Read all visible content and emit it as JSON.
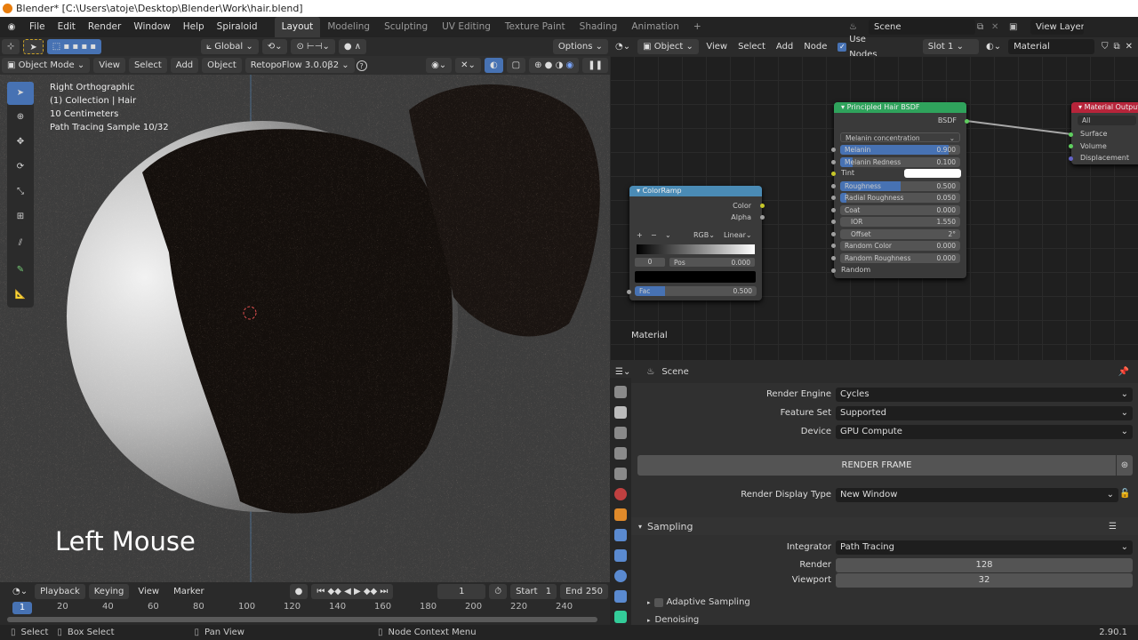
{
  "window": {
    "title": "Blender* [C:\\Users\\atoje\\Desktop\\Blender\\Work\\hair.blend]"
  },
  "menu": [
    "File",
    "Edit",
    "Render",
    "Window",
    "Help",
    "Spiraloid"
  ],
  "workspaces": [
    "Layout",
    "Modeling",
    "Sculpting",
    "UV Editing",
    "Texture Paint",
    "Shading",
    "Animation"
  ],
  "workspace_add": "+",
  "topright": {
    "scene": "Scene",
    "view_layer": "View Layer"
  },
  "tool_header": {
    "orientation": "Global",
    "options": "Options"
  },
  "viewport_header": {
    "mode": "Object Mode",
    "items": [
      "View",
      "Select",
      "Add",
      "Object"
    ],
    "addon": "RetopoFlow 3.0.0β2",
    "help": "?"
  },
  "viewport": {
    "overlay": [
      "Right Orthographic",
      "(1) Collection | Hair",
      "10 Centimeters",
      "Path Tracing Sample 10/32"
    ],
    "key_hint": "Left Mouse"
  },
  "timeline": {
    "menus": [
      "Playback",
      "Keying",
      "View",
      "Marker"
    ],
    "current_frame": "1",
    "start_label": "Start",
    "start": "1",
    "end_label": "End",
    "end": "250",
    "ticks": [
      "20",
      "40",
      "60",
      "80",
      "100",
      "120",
      "140",
      "160",
      "180",
      "200",
      "220",
      "240"
    ],
    "playhead": "1"
  },
  "status": {
    "select": "Select",
    "box_select": "Box Select",
    "pan": "Pan View",
    "context": "Node Context Menu",
    "version": "2.90.1"
  },
  "node_header": {
    "object": "Object",
    "items": [
      "View",
      "Select",
      "Add",
      "Node"
    ],
    "use_nodes": "Use Nodes",
    "use_nodes_checked": true,
    "slot": "Slot 1",
    "material": "Material"
  },
  "node_tree_label": "Material",
  "colorramp": {
    "title": "ColorRamp",
    "outputs": [
      "Color",
      "Alpha"
    ],
    "mode": "RGB",
    "interp": "Linear",
    "index": "0",
    "pos_label": "Pos",
    "pos": "0.000",
    "fac_label": "Fac",
    "fac": "0.500",
    "fac_value": 0.5,
    "header_color": "#4a8bb5"
  },
  "hair_bsdf": {
    "title": "Principled Hair BSDF",
    "output": "BSDF",
    "param": "Melanin concentration",
    "header_color": "#2fa35c",
    "fields": [
      {
        "label": "Melanin",
        "value": "0.900",
        "fill": 0.9
      },
      {
        "label": "Melanin Redness",
        "value": "0.100",
        "fill": 0.1
      },
      {
        "label": "Tint",
        "value": "",
        "fill": 0
      },
      {
        "label": "Roughness",
        "value": "0.500",
        "fill": 0.5
      },
      {
        "label": "Radial Roughness",
        "value": "0.050",
        "fill": 0.05
      },
      {
        "label": "Coat",
        "value": "0.000",
        "fill": 0
      },
      {
        "label": "IOR",
        "value": "1.550",
        "fill": 0
      },
      {
        "label": "Offset",
        "value": "2°",
        "fill": 0
      },
      {
        "label": "Random Color",
        "value": "0.000",
        "fill": 0
      },
      {
        "label": "Random Roughness",
        "value": "0.000",
        "fill": 0
      }
    ],
    "random": "Random"
  },
  "material_output": {
    "title": "Material Output",
    "target": "All",
    "inputs": [
      "Surface",
      "Volume",
      "Displacement"
    ],
    "header_color": "#b7243a"
  },
  "properties": {
    "context": "Scene",
    "render_engine_label": "Render Engine",
    "render_engine": "Cycles",
    "feature_set_label": "Feature Set",
    "feature_set": "Supported",
    "device_label": "Device",
    "device": "GPU Compute",
    "render_frame": "RENDER FRAME",
    "display_type_label": "Render Display Type",
    "display_type": "New Window",
    "sampling": "Sampling",
    "integrator_label": "Integrator",
    "integrator": "Path Tracing",
    "render_label": "Render",
    "render_samples": "128",
    "viewport_label": "Viewport",
    "viewport_samples": "32",
    "adaptive": "Adaptive Sampling",
    "denoising": "Denoising"
  }
}
